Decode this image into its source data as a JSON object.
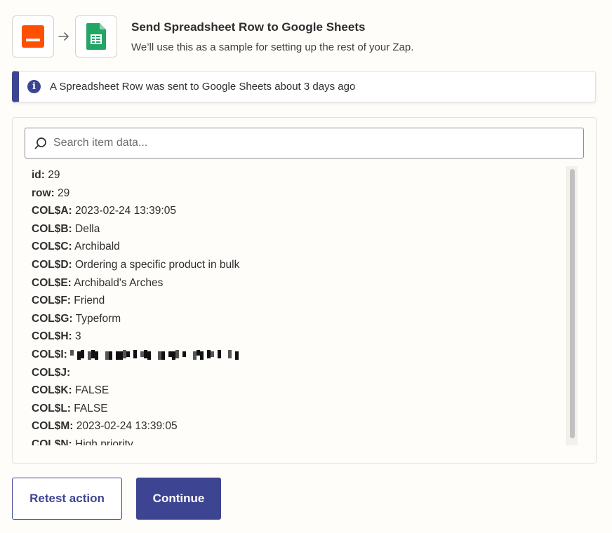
{
  "header": {
    "title": "Send Spreadsheet Row to Google Sheets",
    "subtitle": "We’ll use this as a sample for setting up the rest of your Zap.",
    "trigger_icon": "orange-app-icon",
    "action_icon": "google-sheets-icon"
  },
  "alert": {
    "text": "A Spreadsheet Row was sent to Google Sheets about 3 days ago",
    "icon": "info-icon"
  },
  "search": {
    "placeholder": "Search item data..."
  },
  "fields": [
    {
      "key": "id:",
      "value": "29"
    },
    {
      "key": "row:",
      "value": "29"
    },
    {
      "key": "COL$A:",
      "value": "2023-02-24 13:39:05"
    },
    {
      "key": "COL$B:",
      "value": "Della"
    },
    {
      "key": "COL$C:",
      "value": "Archibald"
    },
    {
      "key": "COL$D:",
      "value": "Ordering a specific product in bulk"
    },
    {
      "key": "COL$E:",
      "value": "Archibald's Arches"
    },
    {
      "key": "COL$F:",
      "value": "Friend"
    },
    {
      "key": "COL$G:",
      "value": "Typeform"
    },
    {
      "key": "COL$H:",
      "value": "3"
    },
    {
      "key": "COL$I:",
      "value": ""
    },
    {
      "key": "COL$J:",
      "value": ""
    },
    {
      "key": "COL$K:",
      "value": "FALSE"
    },
    {
      "key": "COL$L:",
      "value": "FALSE"
    },
    {
      "key": "COL$M:",
      "value": "2023-02-24 13:39:05"
    },
    {
      "key": "COL$N:",
      "value": "High priority"
    }
  ],
  "buttons": {
    "retest": "Retest action",
    "continue": "Continue"
  },
  "colors": {
    "accent": "#3d4592",
    "trigger_brand": "#ff4f00",
    "sheets_brand": "#23a566",
    "background": "#fffdf9"
  }
}
